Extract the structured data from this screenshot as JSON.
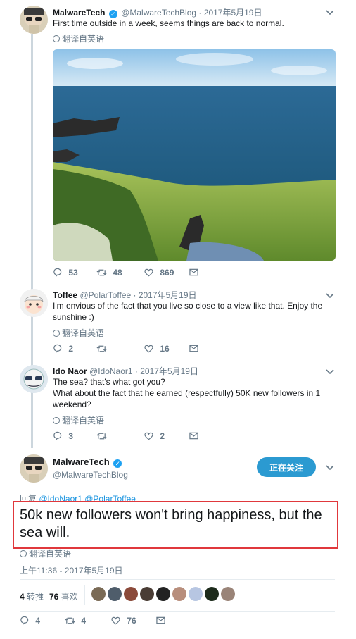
{
  "tweet1": {
    "name": "MalwareTech",
    "handle": "@MalwareTechBlog",
    "dot": "·",
    "time": "2017年5月19日",
    "text": "First time outside in a week, seems things are back to normal.",
    "translate": "翻译自英语",
    "replies": "53",
    "retweets": "48",
    "likes": "869"
  },
  "tweet2": {
    "name": "Toffee",
    "handle": "@PolarToffee",
    "dot": "·",
    "time": "2017年5月19日",
    "text": "I'm envious of the fact that you live so close to a view like that. Enjoy the sunshine :)",
    "translate": "翻译自英语",
    "replies": "2",
    "retweets": "",
    "likes": "16"
  },
  "tweet3": {
    "name": "Ido Naor",
    "handle": "@IdoNaor1",
    "dot": "·",
    "time": "2017年5月19日",
    "line1": "The sea? that's what got you?",
    "line2": "What about the fact that he earned (respectfully) 50K new followers in 1 weekend?",
    "translate": "翻译自英语",
    "replies": "3",
    "retweets": "",
    "likes": "2"
  },
  "main": {
    "name": "MalwareTech",
    "handle": "@MalwareTechBlog",
    "follow_label": "正在关注",
    "reply_prefix": "回复",
    "reply_user1": "@IdoNaor1",
    "reply_user2": "@PolarToffee",
    "text": "50k new followers won't bring happiness, but the sea will.",
    "translate": "翻译自英语",
    "timestamp": "上午11:36 - 2017年5月19日",
    "retweet_count": "4",
    "retweet_label": "转推",
    "like_count": "76",
    "like_label": "喜欢",
    "replies": "4",
    "retweets": "4",
    "likes": "76"
  },
  "icons": {
    "reply": "reply-icon",
    "retweet": "retweet-icon",
    "like": "heart-icon",
    "dm": "envelope-icon",
    "verified": "verified-icon",
    "more": "chevron-down-icon",
    "translate": "globe-icon"
  },
  "colors": {
    "accent": "#1da1f2",
    "follow_button": "#2b9ad1",
    "highlight_border": "#e0383c",
    "muted": "#657786",
    "thread_line": "#ccd6dd"
  }
}
